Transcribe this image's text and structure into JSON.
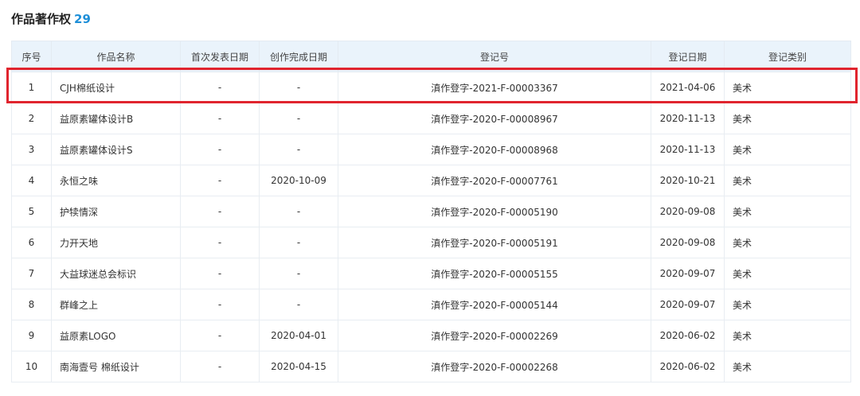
{
  "section": {
    "title": "作品著作权",
    "count": "29"
  },
  "table": {
    "headers": [
      "序号",
      "作品名称",
      "首次发表日期",
      "创作完成日期",
      "登记号",
      "登记日期",
      "登记类别"
    ],
    "rows": [
      {
        "no": "1",
        "name": "CJH棉纸设计",
        "first_pub": "-",
        "completed": "-",
        "reg_no": "滇作登字-2021-F-00003367",
        "reg_date": "2021-04-06",
        "category": "美术"
      },
      {
        "no": "2",
        "name": "益原素罐体设计B",
        "first_pub": "-",
        "completed": "-",
        "reg_no": "滇作登字-2020-F-00008967",
        "reg_date": "2020-11-13",
        "category": "美术"
      },
      {
        "no": "3",
        "name": "益原素罐体设计S",
        "first_pub": "-",
        "completed": "-",
        "reg_no": "滇作登字-2020-F-00008968",
        "reg_date": "2020-11-13",
        "category": "美术"
      },
      {
        "no": "4",
        "name": "永恒之味",
        "first_pub": "-",
        "completed": "2020-10-09",
        "reg_no": "滇作登字-2020-F-00007761",
        "reg_date": "2020-10-21",
        "category": "美术"
      },
      {
        "no": "5",
        "name": "护犊情深",
        "first_pub": "-",
        "completed": "-",
        "reg_no": "滇作登字-2020-F-00005190",
        "reg_date": "2020-09-08",
        "category": "美术"
      },
      {
        "no": "6",
        "name": "力开天地",
        "first_pub": "-",
        "completed": "-",
        "reg_no": "滇作登字-2020-F-00005191",
        "reg_date": "2020-09-08",
        "category": "美术"
      },
      {
        "no": "7",
        "name": "大益球迷总会标识",
        "first_pub": "-",
        "completed": "-",
        "reg_no": "滇作登字-2020-F-00005155",
        "reg_date": "2020-09-07",
        "category": "美术"
      },
      {
        "no": "8",
        "name": "群峰之上",
        "first_pub": "-",
        "completed": "-",
        "reg_no": "滇作登字-2020-F-00005144",
        "reg_date": "2020-09-07",
        "category": "美术"
      },
      {
        "no": "9",
        "name": "益原素LOGO",
        "first_pub": "-",
        "completed": "2020-04-01",
        "reg_no": "滇作登字-2020-F-00002269",
        "reg_date": "2020-06-02",
        "category": "美术"
      },
      {
        "no": "10",
        "name": "南海壹号 棉纸设计",
        "first_pub": "-",
        "completed": "2020-04-15",
        "reg_no": "滇作登字-2020-F-00002268",
        "reg_date": "2020-06-02",
        "category": "美术"
      }
    ]
  },
  "colors": {
    "count_accent": "#1e8fd8",
    "header_bg": "#eaf3fb",
    "highlight_border": "#e0242e"
  }
}
